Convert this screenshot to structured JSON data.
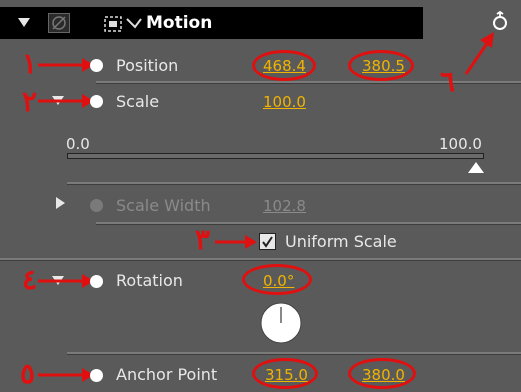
{
  "header": {
    "title": "Motion",
    "fx_icon": "fx-icon",
    "motion_icon": "motion-transform-icon",
    "reset_icon": "reset-icon"
  },
  "position": {
    "label": "Position",
    "x": "468.4",
    "y": "380.5"
  },
  "scale": {
    "label": "Scale",
    "value": "100.0",
    "slider_min": "0.0",
    "slider_max": "100.0"
  },
  "scale_width": {
    "label": "Scale Width",
    "value": "102.8"
  },
  "uniform_scale": {
    "label": "Uniform Scale",
    "checked": true
  },
  "rotation": {
    "label": "Rotation",
    "value": "0.0",
    "unit": "°"
  },
  "anchor_point": {
    "label": "Anchor Point",
    "x": "315.0",
    "y": "380.0"
  },
  "annotations": {
    "n1": "١",
    "n2": "٢",
    "n3": "٣",
    "n4": "٤",
    "n5": "٥",
    "n6": "٦"
  },
  "colors": {
    "panel": "#5a5a5a",
    "header": "#000000",
    "value": "#f0b400",
    "annotation": "#e01010"
  }
}
